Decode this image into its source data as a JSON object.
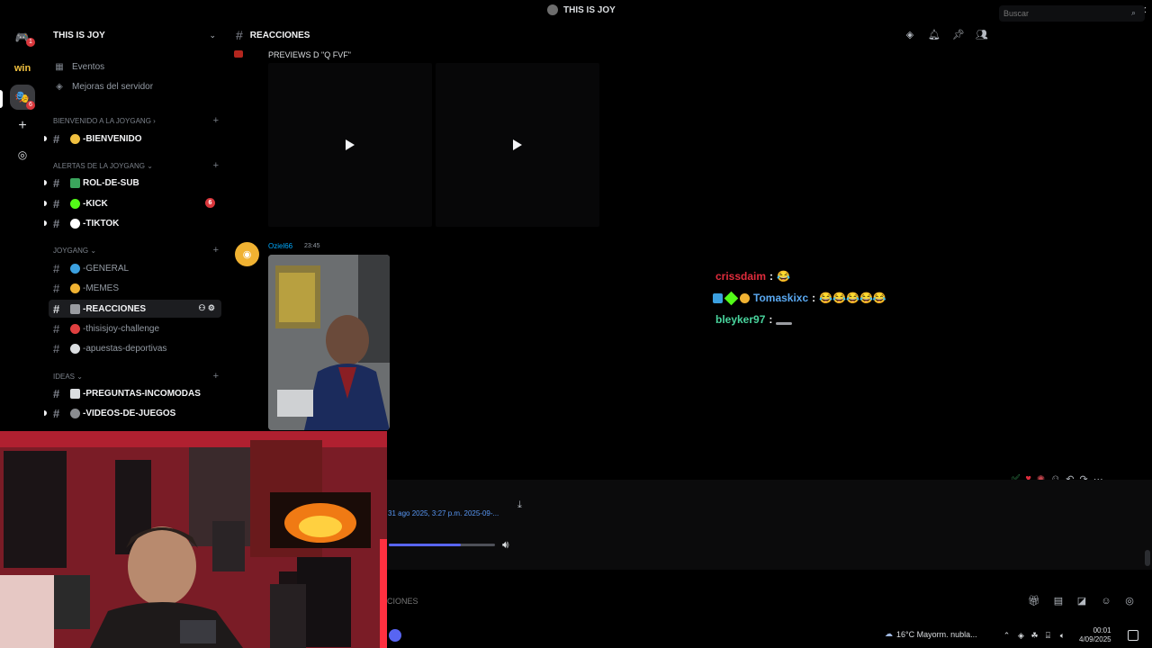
{
  "window": {
    "title": "THIS IS JOY"
  },
  "server": {
    "name": "THIS IS JOY",
    "rail_badges": [
      "1",
      "6"
    ]
  },
  "sidebar": {
    "top_items": [
      {
        "label": "Eventos",
        "icon": "calendar-icon"
      },
      {
        "label": "Mejoras del servidor",
        "icon": "boost-icon"
      }
    ],
    "categories": [
      {
        "name": "BIENVENIDO A LA JOYGANG",
        "chevron": "›"
      },
      {
        "name": "ALERTAS DE LA JOYGANG",
        "chevron": "⌄"
      },
      {
        "name": "JOYGANG",
        "chevron": "⌄"
      },
      {
        "name": "IDEAS",
        "chevron": "⌄"
      }
    ],
    "channels": [
      {
        "label": "-BIENVENIDO",
        "emoji_color": "#f0c040",
        "bold": true
      },
      {
        "label": "ROL-DE-SUB",
        "emoji_color": "#3ba55d",
        "bold": true
      },
      {
        "label": "-KICK",
        "emoji_color": "#53fc18",
        "bold": true,
        "mention": "6"
      },
      {
        "label": "-TIKTOK",
        "emoji_color": "#ffffff",
        "bold": true
      },
      {
        "label": "-GENERAL",
        "emoji_color": "#3ba0e0"
      },
      {
        "label": "-MEMES",
        "emoji_color": "#f0b232"
      },
      {
        "label": "-REACCIONES",
        "emoji_color": "#9a9ca1",
        "active": true
      },
      {
        "label": "-thisisjoy-challenge",
        "emoji_color": "#e04040"
      },
      {
        "label": "-apuestas-deportivas",
        "emoji_color": "#dbdee1"
      },
      {
        "label": "-PREGUNTAS-INCOMODAS",
        "emoji_color": "#dbdee1",
        "bold": true
      },
      {
        "label": "-VIDEOS-DE-JUEGOS",
        "emoji_color": "#8a8c90",
        "bold": true
      }
    ]
  },
  "header": {
    "channel": "REACCIONES",
    "search_placeholder": "Buscar"
  },
  "messages": {
    "preview_text": "PREVIEWS D \"Q FVF\"",
    "author": "Oziel66",
    "time": "23:45"
  },
  "overlay_chat": [
    {
      "user": "crissdaim",
      "color": "#e02c3c",
      "text": "😂"
    },
    {
      "user": "Tomaskixc",
      "color": "#5aa8f0",
      "text": "😂😂😂😂😂"
    },
    {
      "user": "bleyker97",
      "color": "#49d49d",
      "text": ""
    }
  ],
  "attachment": {
    "filename": "31 ago 2025, 3:27 p.m. 2025-09-...",
    "progress": 0.68
  },
  "composer": {
    "placeholder": "CIONES"
  },
  "taskbar": {
    "weather": "16°C  Mayorm. nubla...",
    "time": "00:01",
    "date": "4/09/2025"
  },
  "colors": {
    "accent": "#5865f2",
    "link": "#00a8fc",
    "danger": "#da373c"
  }
}
